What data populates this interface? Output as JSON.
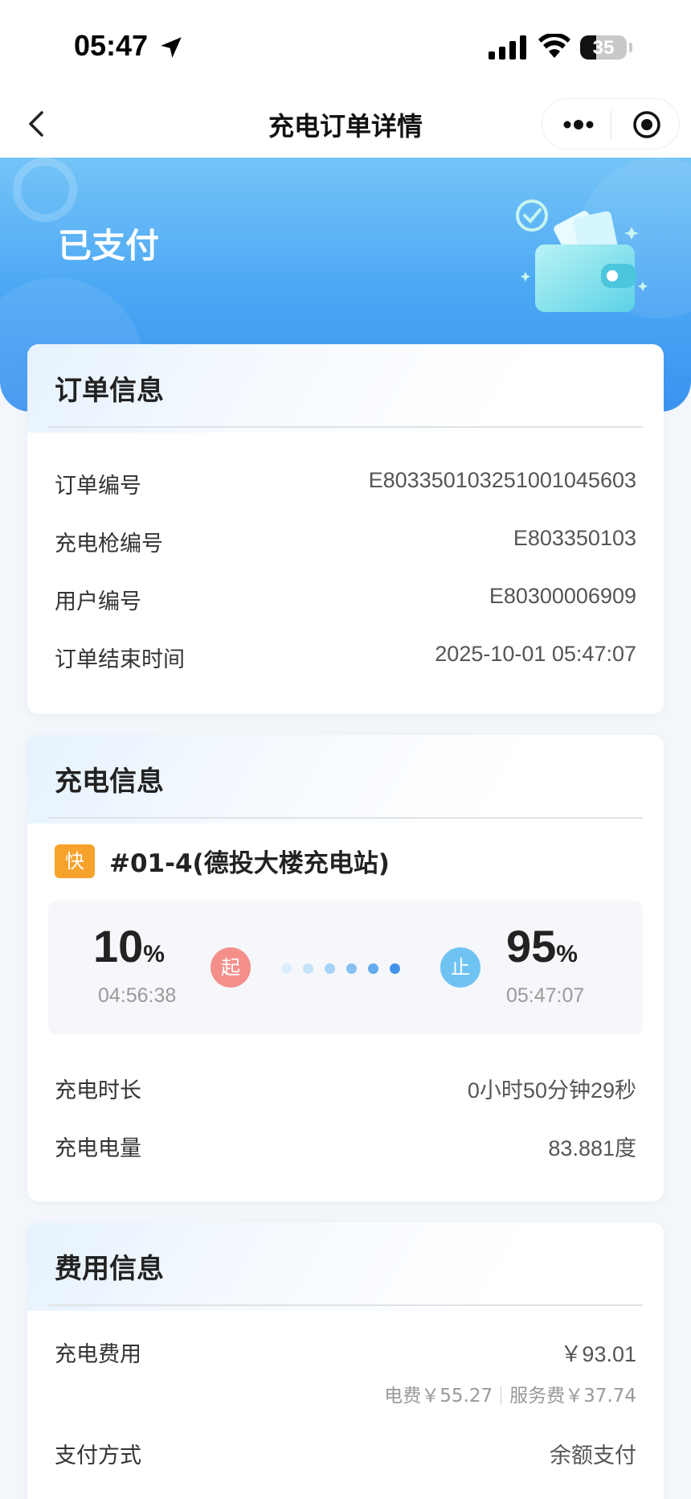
{
  "status_bar": {
    "time": "05:47",
    "battery": "35",
    "battery_level": 0.35
  },
  "nav": {
    "title": "充电订单详情"
  },
  "banner": {
    "status": "已支付"
  },
  "order_info": {
    "title": "订单信息",
    "rows": [
      {
        "label": "订单编号",
        "value": "E80335010325100104 5603"
      },
      {
        "label": "充电枪编号",
        "value": "E803350103"
      },
      {
        "label": "用户编号",
        "value": "E80300006909"
      },
      {
        "label": "订单结束时间",
        "value": "2025-10-01 05:47:07"
      }
    ]
  },
  "charge_info": {
    "title": "充电信息",
    "badge": "快",
    "station": "#01-4(德投大楼充电站)",
    "start_soc": "10",
    "start_time": "04:56:38",
    "start_label": "起",
    "end_soc": "95",
    "end_time": "05:47:07",
    "end_label": "止",
    "percent_sign": "%",
    "rows": [
      {
        "label": "充电时长",
        "value": "0小时50分钟29秒"
      },
      {
        "label": "充电电量",
        "value": "83.881度"
      }
    ]
  },
  "fee_info": {
    "title": "费用信息",
    "charge_fee_label": "充电费用",
    "charge_fee_value": "￥93.01",
    "electricity_fee": "电费￥55.27",
    "service_fee": "服务费￥37.74",
    "pay_method_label": "支付方式",
    "pay_method_value": "余额支付"
  },
  "colors": {
    "banner": "#4aa6f4",
    "fast_badge": "#f7a22b",
    "start_badge": "#f48f8a",
    "end_badge": "#6fc3f2"
  }
}
